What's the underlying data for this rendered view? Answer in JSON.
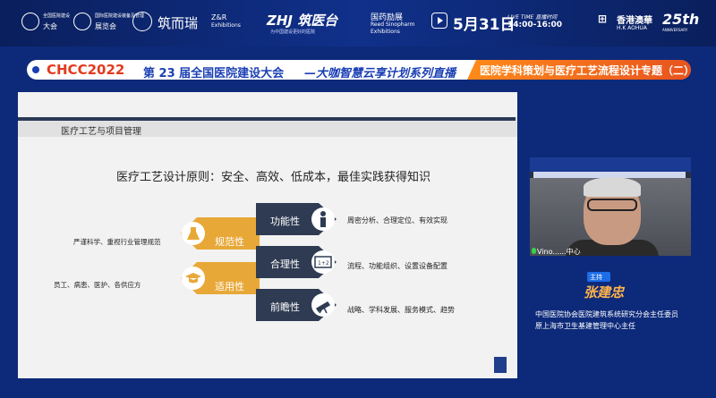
{
  "sponsors": {
    "org1": "大会",
    "org1_small": "全国医院建设",
    "org2_small": "国际医院建设装备及管理",
    "org2": "展览会",
    "zhulier": "筑而瑞",
    "zr": "Z&R",
    "exhibitions": "Exhibitions",
    "zhj": "ZHJ 筑医台",
    "zhj_slogan": "为中国建设更好的医院",
    "guoyao": "国药励展",
    "reed": "Reed Sinopharm",
    "reed2": "Exhibitions",
    "date": "5月31日",
    "live_label": "LIVE TIME 直播时间",
    "time": "14:00-16:00",
    "hk": "香港澳華",
    "hk_en": "H.K AOHUA",
    "anniv": "25th",
    "anniv_sub": "ANNIVERSARY"
  },
  "banner": {
    "chcc": "CHCC",
    "year": "2022",
    "title": "第 23 届全国医院建设大会",
    "series": "—大咖智慧云享计划系列直播",
    "topic": "医院学科策划与医疗工艺流程设计专题（二）"
  },
  "slide": {
    "section": "医疗工艺与项目管理",
    "principle": "医疗工艺设计原则：安全、高效、低成本，最佳实践获得知识",
    "left_items": [
      {
        "label": "严谨科学、重视行业管理规范",
        "arrow": "规范性"
      },
      {
        "label": "员工、病患、医护、各供应方",
        "arrow": "适用性"
      }
    ],
    "right_items": [
      {
        "arrow": "功能性",
        "label": "周密分析、合理定位、有效实现"
      },
      {
        "arrow": "合理性",
        "label": "流程、功能组织、设置设备配置"
      },
      {
        "arrow": "前瞻性",
        "label": "战略、学科发展、服务模式、趋势"
      }
    ],
    "formula_icon": "1+2"
  },
  "video": {
    "participant": "Vino......中心"
  },
  "host": {
    "badge": "主持",
    "name": "张建忠",
    "title1": "中国医院协会医院建筑系统研究分会主任委员",
    "title2": "原上海市卫生基建管理中心主任"
  },
  "colors": {
    "background": "#0d2a7a",
    "accent_orange": "#e8a838",
    "arrow_dark": "#2e3b52",
    "banner_red": "#e23a1e",
    "banner_blue": "#1a3fb4",
    "host_gold": "#ffb44a"
  }
}
